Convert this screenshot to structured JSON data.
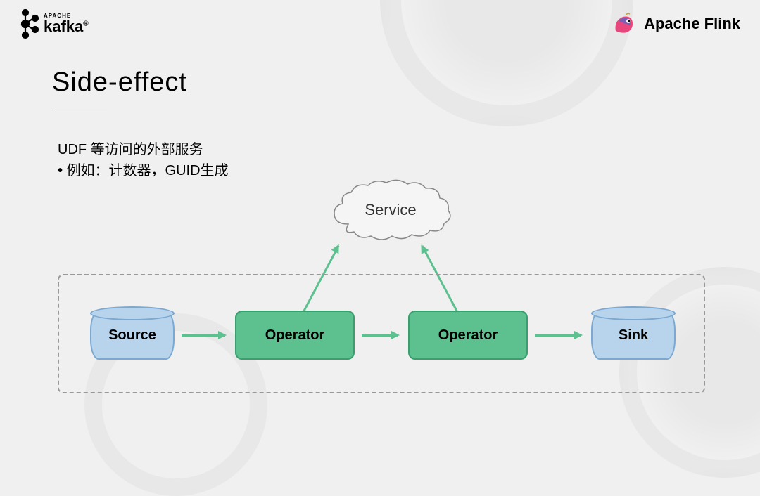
{
  "header": {
    "kafka_super": "APACHE",
    "kafka_name": "kafka",
    "flink_name": "Apache Flink"
  },
  "title": "Side-effect",
  "desc": "UDF 等访问的外部服务",
  "bullet": "例如：计数器，GUID生成",
  "nodes": {
    "service": "Service",
    "source": "Source",
    "operator1": "Operator",
    "operator2": "Operator",
    "sink": "Sink"
  }
}
